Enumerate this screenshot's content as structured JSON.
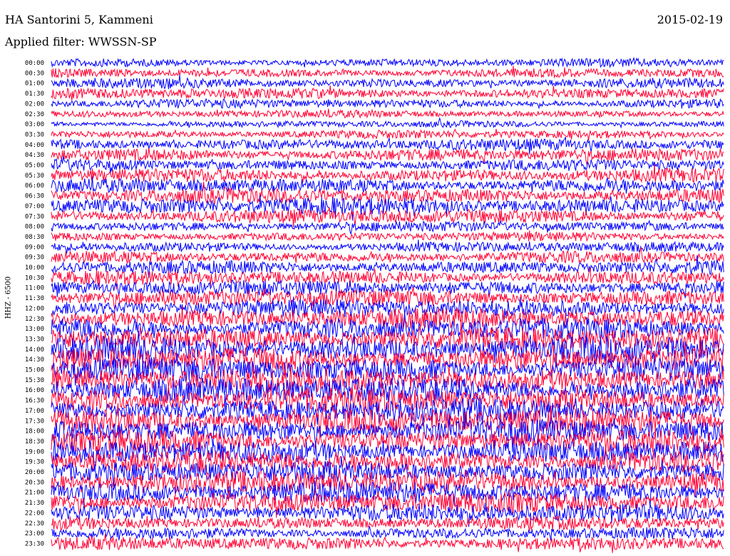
{
  "header": {
    "station": "HA Santorini 5, Kammeni",
    "filter": "Applied filter: WWSSN-SP",
    "date": "2015-02-19",
    "channel": "HHZ - 6500"
  },
  "colors": {
    "trace_a": "#0000ff",
    "trace_b": "#ff0033",
    "background": "#ffffff"
  },
  "chart_data": {
    "type": "line",
    "title": "HA Santorini 5, Kammeni",
    "subtitle": "Applied filter: WWSSN-SP",
    "ylabel": "HHZ - 6500",
    "row_labels": [
      "00:00",
      "00:30",
      "01:00",
      "01:30",
      "02:00",
      "02:30",
      "03:00",
      "03:30",
      "04:00",
      "04:30",
      "05:00",
      "05:30",
      "06:00",
      "06:30",
      "07:00",
      "07:30",
      "08:00",
      "08:30",
      "09:00",
      "09:30",
      "10:00",
      "10:30",
      "11:00",
      "11:30",
      "12:00",
      "12:30",
      "13:00",
      "13:30",
      "14:00",
      "14:30",
      "15:00",
      "15:30",
      "16:00",
      "16:30",
      "17:00",
      "17:30",
      "18:00",
      "18:30",
      "19:00",
      "19:30",
      "20:00",
      "20:30",
      "21:00",
      "21:30",
      "22:00",
      "22:30",
      "23:00",
      "23:30"
    ],
    "row_colors": [
      "blue",
      "red"
    ],
    "relative_amplitude": [
      0.5,
      0.55,
      0.6,
      0.65,
      0.55,
      0.45,
      0.4,
      0.5,
      0.7,
      0.75,
      0.7,
      0.8,
      0.85,
      0.9,
      1.0,
      0.85,
      0.6,
      0.55,
      0.6,
      0.7,
      0.8,
      0.85,
      0.9,
      1.0,
      1.1,
      1.2,
      1.3,
      1.4,
      1.5,
      1.5,
      1.45,
      1.5,
      1.55,
      1.5,
      1.45,
      1.5,
      1.45,
      1.4,
      1.4,
      1.35,
      1.3,
      1.35,
      1.3,
      1.25,
      1.1,
      0.8,
      0.7,
      0.8
    ]
  }
}
